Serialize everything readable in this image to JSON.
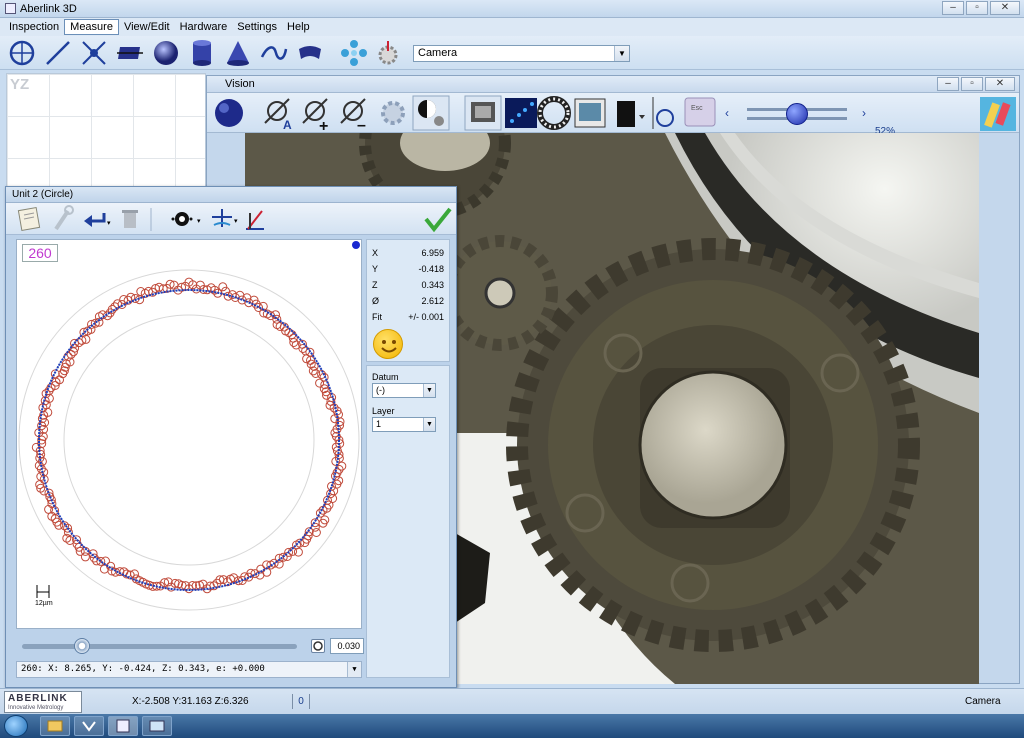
{
  "app": {
    "title": "Aberlink 3D"
  },
  "menu": [
    "Inspection",
    "Measure",
    "View/Edit",
    "Hardware",
    "Settings",
    "Help"
  ],
  "menu_active": "Measure",
  "toolbar": {
    "icons": [
      "circle-tool-icon",
      "line-tool-icon",
      "point-tool-icon",
      "plane-tool-icon",
      "sphere-tool-icon",
      "cylinder-tool-icon",
      "cone-tool-icon",
      "curve-tool-icon",
      "surface-tool-icon",
      "probe-cluster-icon",
      "probe-settings-icon"
    ],
    "camera_select": "Camera"
  },
  "workspace": {
    "plane_label": "YZ"
  },
  "vision": {
    "title": "Vision",
    "zoom_percent": "52%",
    "light_level": 0.5
  },
  "unit": {
    "title": "Unit 2 (Circle)",
    "point_count": "260",
    "scale_label": "12µm",
    "results": [
      {
        "k": "X",
        "v": "6.959"
      },
      {
        "k": "Y",
        "v": "-0.418"
      },
      {
        "k": "Z",
        "v": "0.343"
      },
      {
        "k": "Ø",
        "v": "2.612"
      },
      {
        "k": "Fit",
        "v": "+/- 0.001"
      }
    ],
    "datum_label": "Datum",
    "datum_value": "(-)",
    "layer_label": "Layer",
    "layer_value": "1",
    "tolerance_value": "0.030",
    "slider_position": 0.2,
    "status_line": "260: X:    8.265,  Y:    -0.424,  Z:    0.343,  e: +0.000"
  },
  "statusbar": {
    "logo_text": "ABERLINK",
    "logo_sub": "Innovative Metrology",
    "coords": "X:-2.508 Y:31.163 Z:6.326",
    "zero": "0",
    "camera": "Camera"
  },
  "colors": {
    "accent_blue": "#1f3f9c",
    "point_red": "#c04a3a",
    "check_green": "#3aa83a"
  }
}
